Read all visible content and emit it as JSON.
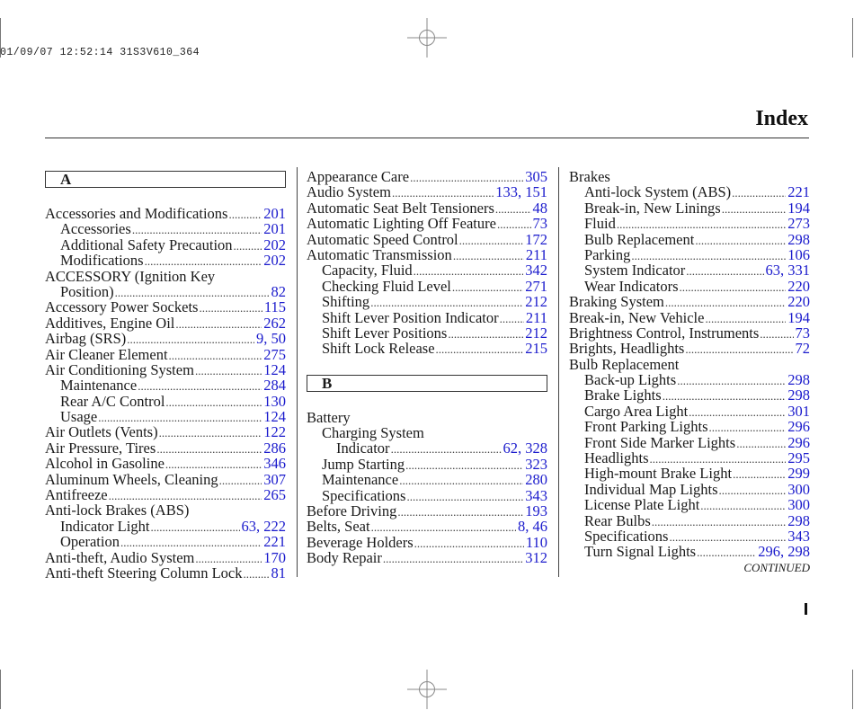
{
  "print_stamp": "01/09/07 12:52:14 31S3V610_364",
  "page_title": "Index",
  "continued_label": "CONTINUED",
  "colors": {
    "page_number": "#1a1acc",
    "text": "#1a1a1a"
  },
  "icons": {
    "registration_mark": "crosshair-circle",
    "page_tab": "black-bar"
  },
  "columns": [
    {
      "sections": [
        {
          "letter": "A",
          "entries": [
            {
              "level": 0,
              "text": "Accessories and Modifications",
              "pages": "201"
            },
            {
              "level": 1,
              "text": "Accessories",
              "pages": "201"
            },
            {
              "level": 1,
              "text": "Additional Safety Precaution",
              "pages": "202"
            },
            {
              "level": 1,
              "text": "Modifications",
              "pages": "202"
            },
            {
              "level": 0,
              "text": "ACCESSORY (Ignition Key",
              "pages": ""
            },
            {
              "level": 1,
              "text": "Position)",
              "pages": "82"
            },
            {
              "level": 0,
              "text": "Accessory Power Sockets",
              "pages": "115"
            },
            {
              "level": 0,
              "text": "Additives, Engine Oil",
              "pages": "262"
            },
            {
              "level": 0,
              "text": "Airbag (SRS)",
              "pages": "9, 50"
            },
            {
              "level": 0,
              "text": "Air Cleaner Element",
              "pages": "275"
            },
            {
              "level": 0,
              "text": "Air Conditioning System",
              "pages": "124"
            },
            {
              "level": 1,
              "text": "Maintenance",
              "pages": "284"
            },
            {
              "level": 1,
              "text": "Rear A/C Control",
              "pages": "130"
            },
            {
              "level": 1,
              "text": "Usage",
              "pages": "124"
            },
            {
              "level": 0,
              "text": "Air Outlets (Vents)",
              "pages": "122"
            },
            {
              "level": 0,
              "text": "Air Pressure, Tires",
              "pages": "286"
            },
            {
              "level": 0,
              "text": "Alcohol in Gasoline",
              "pages": "346"
            },
            {
              "level": 0,
              "text": "Aluminum Wheels, Cleaning",
              "pages": "307"
            },
            {
              "level": 0,
              "text": "Antifreeze",
              "pages": "265"
            },
            {
              "level": 0,
              "text": "Anti-lock Brakes (ABS)",
              "pages": ""
            },
            {
              "level": 1,
              "text": "Indicator Light",
              "pages": "63, 222"
            },
            {
              "level": 1,
              "text": "Operation",
              "pages": "221"
            },
            {
              "level": 0,
              "text": "Anti-theft, Audio System",
              "pages": "170"
            },
            {
              "level": 0,
              "text": "Anti-theft Steering Column Lock",
              "pages": "81"
            }
          ]
        }
      ]
    },
    {
      "sections": [
        {
          "letter": "",
          "entries": [
            {
              "level": 0,
              "text": "Appearance Care",
              "pages": "305"
            },
            {
              "level": 0,
              "text": "Audio System",
              "pages": "133, 151"
            },
            {
              "level": 0,
              "text": "Automatic Seat Belt Tensioners",
              "pages": "48"
            },
            {
              "level": 0,
              "text": "Automatic Lighting Off Feature",
              "pages": "73"
            },
            {
              "level": 0,
              "text": "Automatic Speed Control",
              "pages": "172"
            },
            {
              "level": 0,
              "text": "Automatic Transmission",
              "pages": "211"
            },
            {
              "level": 1,
              "text": "Capacity, Fluid",
              "pages": "342"
            },
            {
              "level": 1,
              "text": "Checking Fluid Level",
              "pages": "271"
            },
            {
              "level": 1,
              "text": "Shifting",
              "pages": "212"
            },
            {
              "level": 1,
              "text": "Shift Lever Position Indicator",
              "pages": "211"
            },
            {
              "level": 1,
              "text": "Shift Lever Positions",
              "pages": "212"
            },
            {
              "level": 1,
              "text": "Shift Lock Release",
              "pages": "215"
            }
          ]
        },
        {
          "letter": "B",
          "entries": [
            {
              "level": 0,
              "text": "Battery",
              "pages": ""
            },
            {
              "level": 1,
              "text": "Charging System",
              "pages": ""
            },
            {
              "level": 2,
              "text": "Indicator",
              "pages": "62, 328"
            },
            {
              "level": 1,
              "text": "Jump Starting",
              "pages": "323"
            },
            {
              "level": 1,
              "text": "Maintenance",
              "pages": "280"
            },
            {
              "level": 1,
              "text": "Specifications",
              "pages": "343"
            },
            {
              "level": 0,
              "text": "Before Driving",
              "pages": "193"
            },
            {
              "level": 0,
              "text": "Belts, Seat",
              "pages": "8, 46"
            },
            {
              "level": 0,
              "text": "Beverage Holders",
              "pages": "110"
            },
            {
              "level": 0,
              "text": "Body Repair",
              "pages": "312"
            }
          ]
        }
      ]
    },
    {
      "sections": [
        {
          "letter": "",
          "entries": [
            {
              "level": 0,
              "text": "Brakes",
              "pages": ""
            },
            {
              "level": 1,
              "text": "Anti-lock System (ABS)",
              "pages": "221"
            },
            {
              "level": 1,
              "text": "Break-in, New Linings",
              "pages": "194"
            },
            {
              "level": 1,
              "text": "Fluid",
              "pages": "273"
            },
            {
              "level": 1,
              "text": "Bulb Replacement",
              "pages": "298"
            },
            {
              "level": 1,
              "text": "Parking",
              "pages": "106"
            },
            {
              "level": 1,
              "text": "System Indicator",
              "pages": "63, 331"
            },
            {
              "level": 1,
              "text": "Wear Indicators",
              "pages": "220"
            },
            {
              "level": 0,
              "text": "Braking System",
              "pages": "220"
            },
            {
              "level": 0,
              "text": "Break-in, New Vehicle",
              "pages": "194"
            },
            {
              "level": 0,
              "text": "Brightness Control, Instruments",
              "pages": "73"
            },
            {
              "level": 0,
              "text": "Brights, Headlights",
              "pages": "72"
            },
            {
              "level": 0,
              "text": "Bulb Replacement",
              "pages": ""
            },
            {
              "level": 1,
              "text": "Back-up Lights",
              "pages": "298"
            },
            {
              "level": 1,
              "text": "Brake Lights",
              "pages": "298"
            },
            {
              "level": 1,
              "text": "Cargo Area Light",
              "pages": "301"
            },
            {
              "level": 1,
              "text": "Front Parking Lights",
              "pages": "296"
            },
            {
              "level": 1,
              "text": "Front Side Marker Lights",
              "pages": "296"
            },
            {
              "level": 1,
              "text": "Headlights",
              "pages": "295"
            },
            {
              "level": 1,
              "text": "High-mount Brake Light",
              "pages": "299"
            },
            {
              "level": 1,
              "text": "Individual Map Lights",
              "pages": "300"
            },
            {
              "level": 1,
              "text": "License Plate Light",
              "pages": "300"
            },
            {
              "level": 1,
              "text": "Rear Bulbs",
              "pages": "298"
            },
            {
              "level": 1,
              "text": "Specifications",
              "pages": "343"
            },
            {
              "level": 1,
              "text": "Turn Signal Lights",
              "pages": "296, 298"
            }
          ]
        }
      ]
    }
  ]
}
